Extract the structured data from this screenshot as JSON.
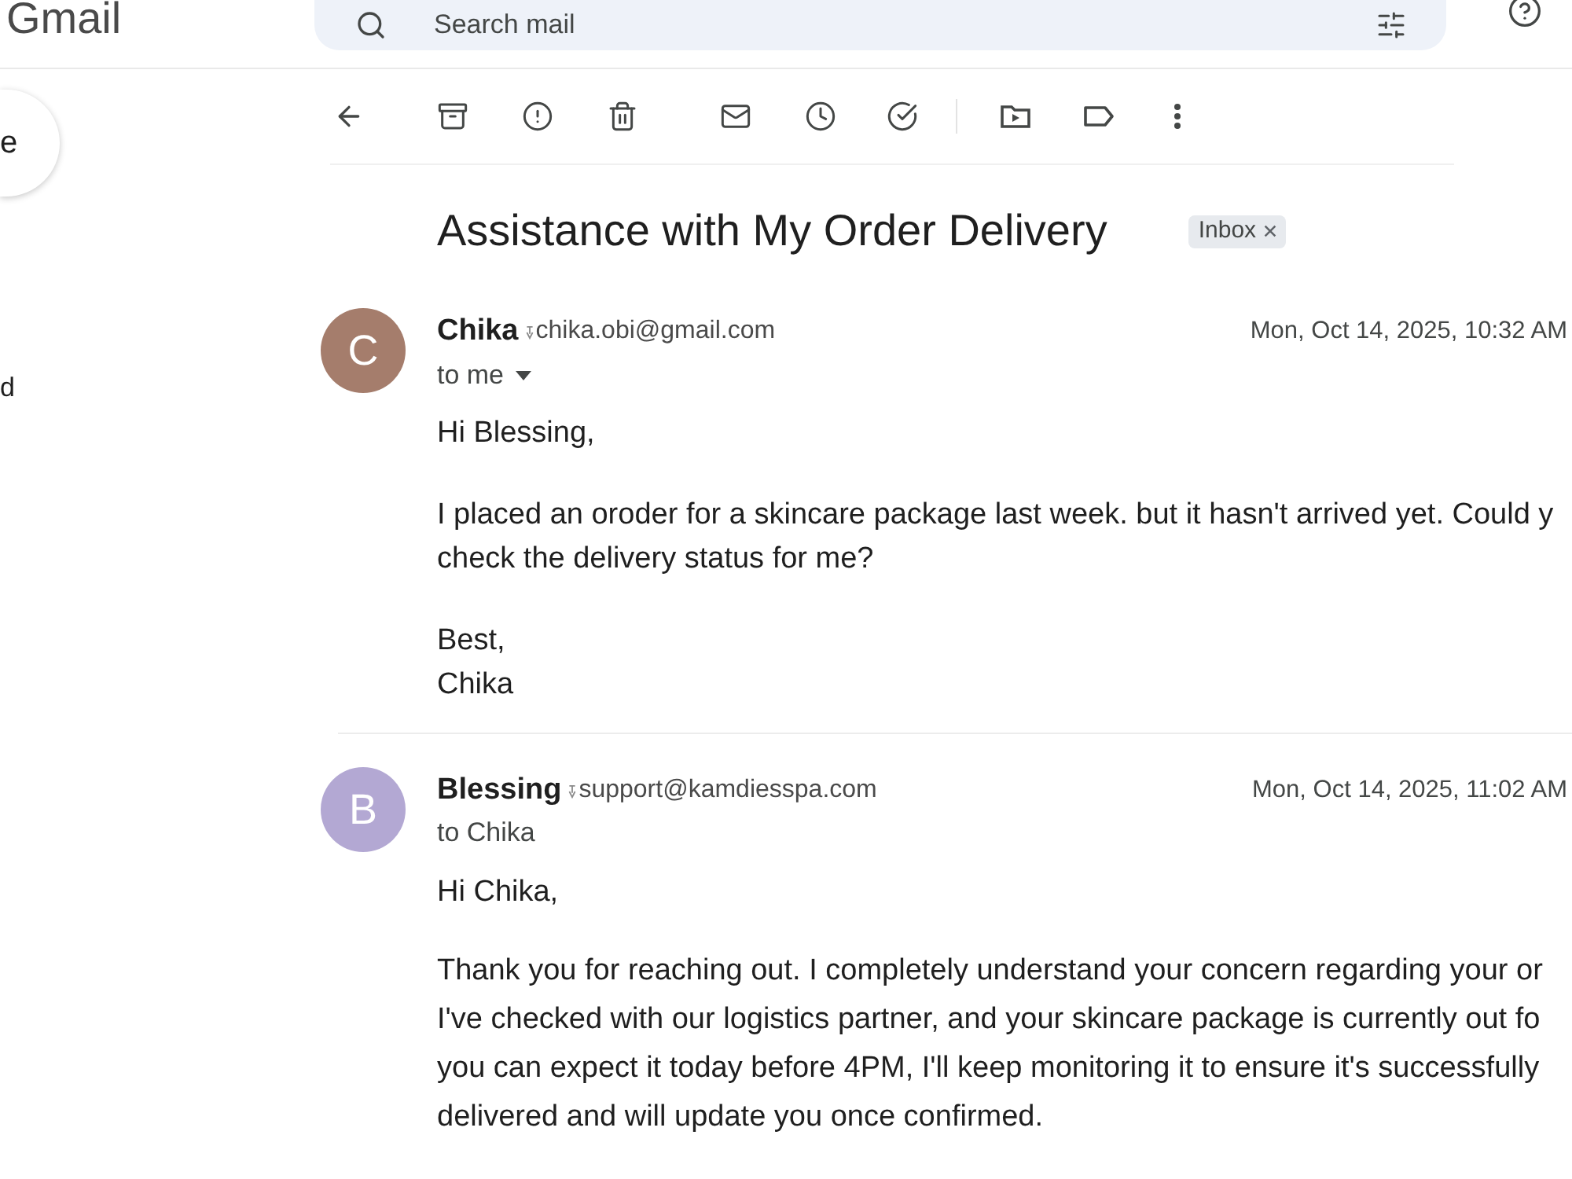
{
  "header": {
    "logo": "Gmail",
    "search": {
      "placeholder": "Search mail"
    }
  },
  "sidebar": {
    "compose_button": {
      "label": "e"
    },
    "items": [
      {
        "label": "d"
      }
    ]
  },
  "thread": {
    "subject": "Assistance with My Order Delivery",
    "labels": [
      {
        "text": "Inbox"
      }
    ]
  },
  "messages": [
    {
      "avatar_letter": "C",
      "color": "#a57d6c",
      "sender": "Chika",
      "email": "chika.obi@gmail.com",
      "date": "Mon, Oct 14, 2025, 10:32 AM",
      "recipients": "to me",
      "details_caret": true,
      "paragraphs": [
        {
          "lines": [
            "Hi Blessing,"
          ]
        },
        {
          "lines": [
            "I placed an oroder for a skincare package last week. but it hasn't arrived yet. Could y",
            "check the delivery status for me?"
          ]
        },
        {
          "lines": [
            "Best,",
            "Chika"
          ]
        }
      ]
    },
    {
      "avatar_letter": "B",
      "color": "#b3a8d3",
      "sender": "Blessing",
      "email": "support@kamdiesspa.com",
      "date": "Mon, Oct 14, 2025, 11:02 AM",
      "recipients": "to Chika",
      "details_caret": false,
      "paragraphs": [
        {
          "lines": [
            "Hi Chika,"
          ]
        },
        {
          "lines": [
            "Thank you for reaching out. I completely understand your concern regarding your or",
            "I've checked with our logistics partner, and your skincare package is currently out fo",
            "you can expect it today before 4PM, I'll keep monitoring it to ensure it's successfully",
            "delivered and will update you once confirmed."
          ]
        }
      ]
    }
  ]
}
